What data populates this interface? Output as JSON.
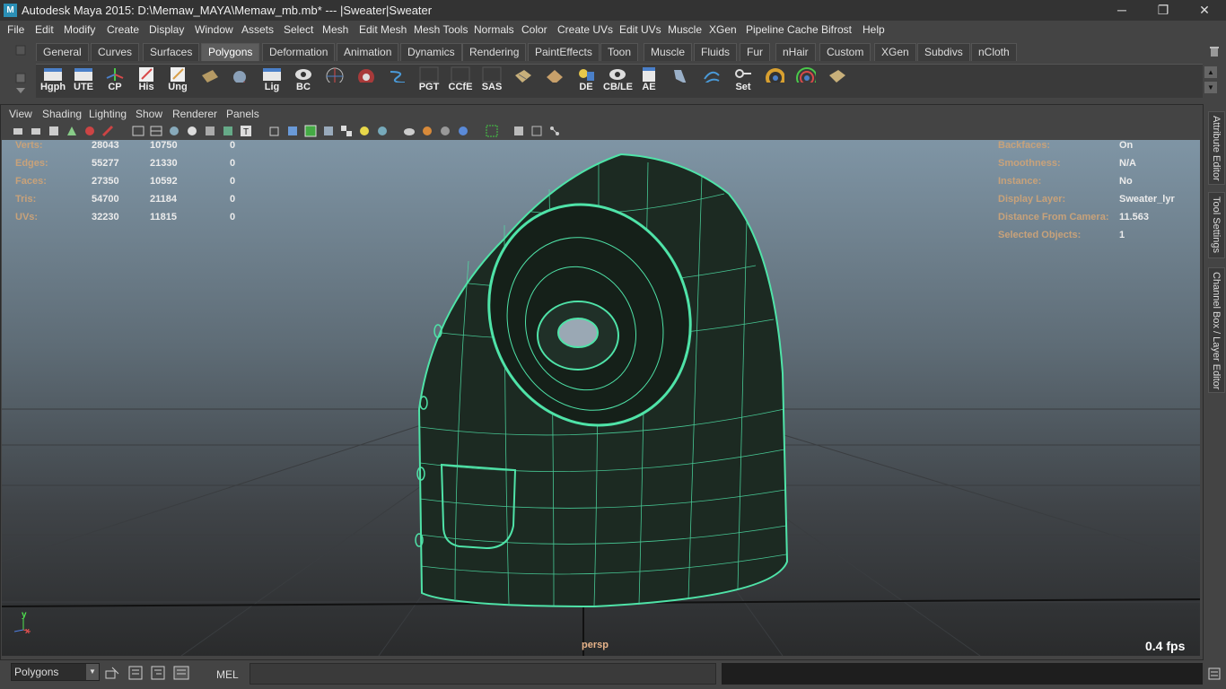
{
  "window": {
    "title": "Autodesk Maya 2015: D:\\Memaw_MAYA\\Memaw_mb.mb*   ---   |Sweater|Sweater",
    "logo_letter": "M",
    "controls": [
      "─",
      "❐",
      "✕"
    ]
  },
  "menubar": [
    "File",
    "Edit",
    "Modify",
    "Create",
    "Display",
    "Window",
    "Assets",
    "Select",
    "Mesh",
    "Edit Mesh",
    "Mesh Tools",
    "Normals",
    "Color",
    "Create UVs",
    "Edit UVs",
    "Muscle",
    "XGen",
    "Pipeline Cache",
    "Bifrost",
    "Help"
  ],
  "shelf": {
    "tabs": [
      "General",
      "Curves",
      "Surfaces",
      "Polygons",
      "Deformation",
      "Animation",
      "Dynamics",
      "Rendering",
      "PaintEffects",
      "Toon",
      "Muscle",
      "Fluids",
      "Fur",
      "nHair",
      "Custom",
      "XGen",
      "Subdivs",
      "nCloth"
    ],
    "active_tab": "Polygons",
    "buttons": [
      "Hgph",
      "UTE",
      "CP",
      "His",
      "Ung",
      "",
      "",
      "Lig",
      "BC",
      "",
      "",
      "",
      "PGT",
      "CCfE",
      "SAS",
      "",
      "",
      "DE",
      "CB/LE",
      "AE",
      "",
      "",
      "Set",
      "",
      ""
    ]
  },
  "panel": {
    "menu": [
      "View",
      "Shading",
      "Lighting",
      "Show",
      "Renderer",
      "Panels"
    ]
  },
  "hud_left": [
    {
      "label": "Verts:",
      "a": "28043",
      "b": "10750",
      "c": "0"
    },
    {
      "label": "Edges:",
      "a": "55277",
      "b": "21330",
      "c": "0"
    },
    {
      "label": "Faces:",
      "a": "27350",
      "b": "10592",
      "c": "0"
    },
    {
      "label": "Tris:",
      "a": "54700",
      "b": "21184",
      "c": "0"
    },
    {
      "label": "UVs:",
      "a": "32230",
      "b": "11815",
      "c": "0"
    }
  ],
  "hud_right": [
    {
      "label": "Backfaces:",
      "value": "On"
    },
    {
      "label": "Smoothness:",
      "value": "N/A"
    },
    {
      "label": "Instance:",
      "value": "No"
    },
    {
      "label": "Display Layer:",
      "value": "Sweater_lyr"
    },
    {
      "label": "Distance From Camera:",
      "value": "11.563"
    },
    {
      "label": "Selected Objects:",
      "value": "1"
    }
  ],
  "viewport": {
    "camera": "persp",
    "fps": "0.4 fps",
    "axis_y": "y",
    "axis_x": "x",
    "wire_color": "#4fe3a8"
  },
  "side_tabs": [
    "Attribute Editor",
    "Tool Settings",
    "Channel Box / Layer Editor"
  ],
  "bottom": {
    "mode": "Polygons",
    "mel_label": "MEL",
    "command": ""
  }
}
